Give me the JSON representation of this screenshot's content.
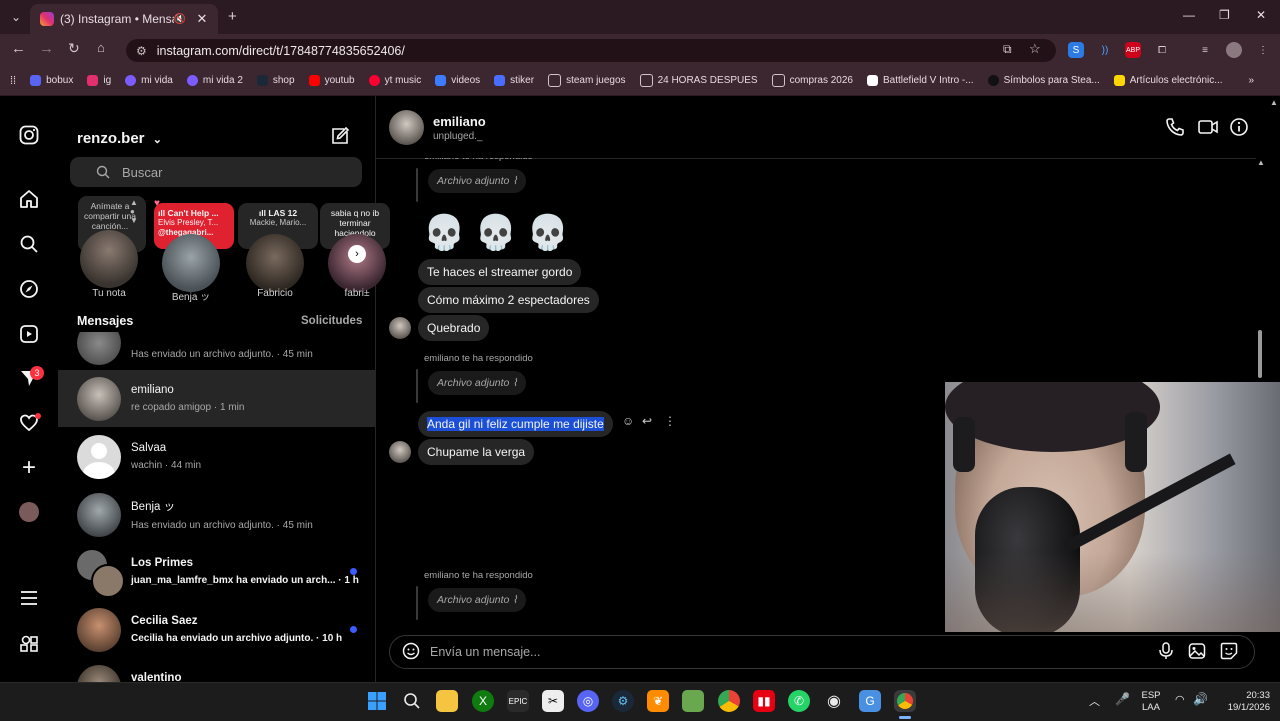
{
  "browser": {
    "tab_title": "(3) Instagram • Mensajes",
    "url": "instagram.com/direct/t/17848774835652406/",
    "bookmarks": [
      "bobux",
      "ig",
      "mi vida",
      "mi vida 2",
      "shop",
      "youtub",
      "yt music",
      "videos",
      "stiker",
      "steam juegos",
      "24 HORAS DESPUES",
      "compras 2026",
      "Battlefield V Intro -...",
      "Símbolos para Stea...",
      "Artículos electrónic..."
    ]
  },
  "sidebar": {
    "notification_badge": "3"
  },
  "inbox": {
    "username": "renzo.ber",
    "search_placeholder": "Buscar",
    "notes": {
      "own_prompt": "Anímate a compartir una canción...",
      "own_name": "Tu nota",
      "note2_title": "Can't Help ...",
      "note2_sub": "Elvis Presley, T...",
      "note2_handle": "@thegagabri...",
      "note2_name": "Benja ッ",
      "note3_title": "LAS 12",
      "note3_sub": "Mackie, Mario...",
      "note3_name": "Fabricio",
      "note4_text": "sabia q no ib terminar haciendolo",
      "note4_name": "fabri±"
    },
    "messages_label": "Mensajes",
    "requests_label": "Solicitudes",
    "conversations": [
      {
        "name": "",
        "preview": "Has enviado un archivo adjunto. · 45 min",
        "unread": false
      },
      {
        "name": "emiliano",
        "preview": "re copado amigop · 1 min",
        "unread": false
      },
      {
        "name": "Salvaa",
        "preview": "wachin · 44 min",
        "unread": false
      },
      {
        "name": "Benja ッ",
        "preview": "Has enviado un archivo adjunto. · 45 min",
        "unread": false
      },
      {
        "name": "Los Primes",
        "preview": "juan_ma_lamfre_bmx ha enviado un arch... · 1 h",
        "unread": true
      },
      {
        "name": "Cecilia Saez",
        "preview": "Cecilia ha enviado un archivo adjunto. · 10 h",
        "unread": true
      },
      {
        "name": "valentino",
        "preview": "",
        "unread": false
      }
    ]
  },
  "chat": {
    "contact_name": "emiliano",
    "contact_status": "unpluged._",
    "reply_label": "emiliano te ha respondido",
    "attachment_label": "Archivo adjunto",
    "skulls": "💀 💀 💀",
    "msg1": "Te haces el streamer gordo",
    "msg2": "Cómo máximo 2 espectadores",
    "msg3": "Quebrado",
    "msg4": "Anda gil ni feliz cumple me dijiste",
    "msg5": "Chupame la verga",
    "composer_placeholder": "Envía un mensaje..."
  },
  "taskbar": {
    "lang": "ESP",
    "lang_sub": "LAA",
    "time": "20:33",
    "date": "19/1/2026"
  },
  "colors": {
    "accent_blue": "#3b5cff",
    "selection_blue": "#1a4fd6",
    "bubble_grey": "#262626",
    "browser_bg": "#3c2630"
  }
}
